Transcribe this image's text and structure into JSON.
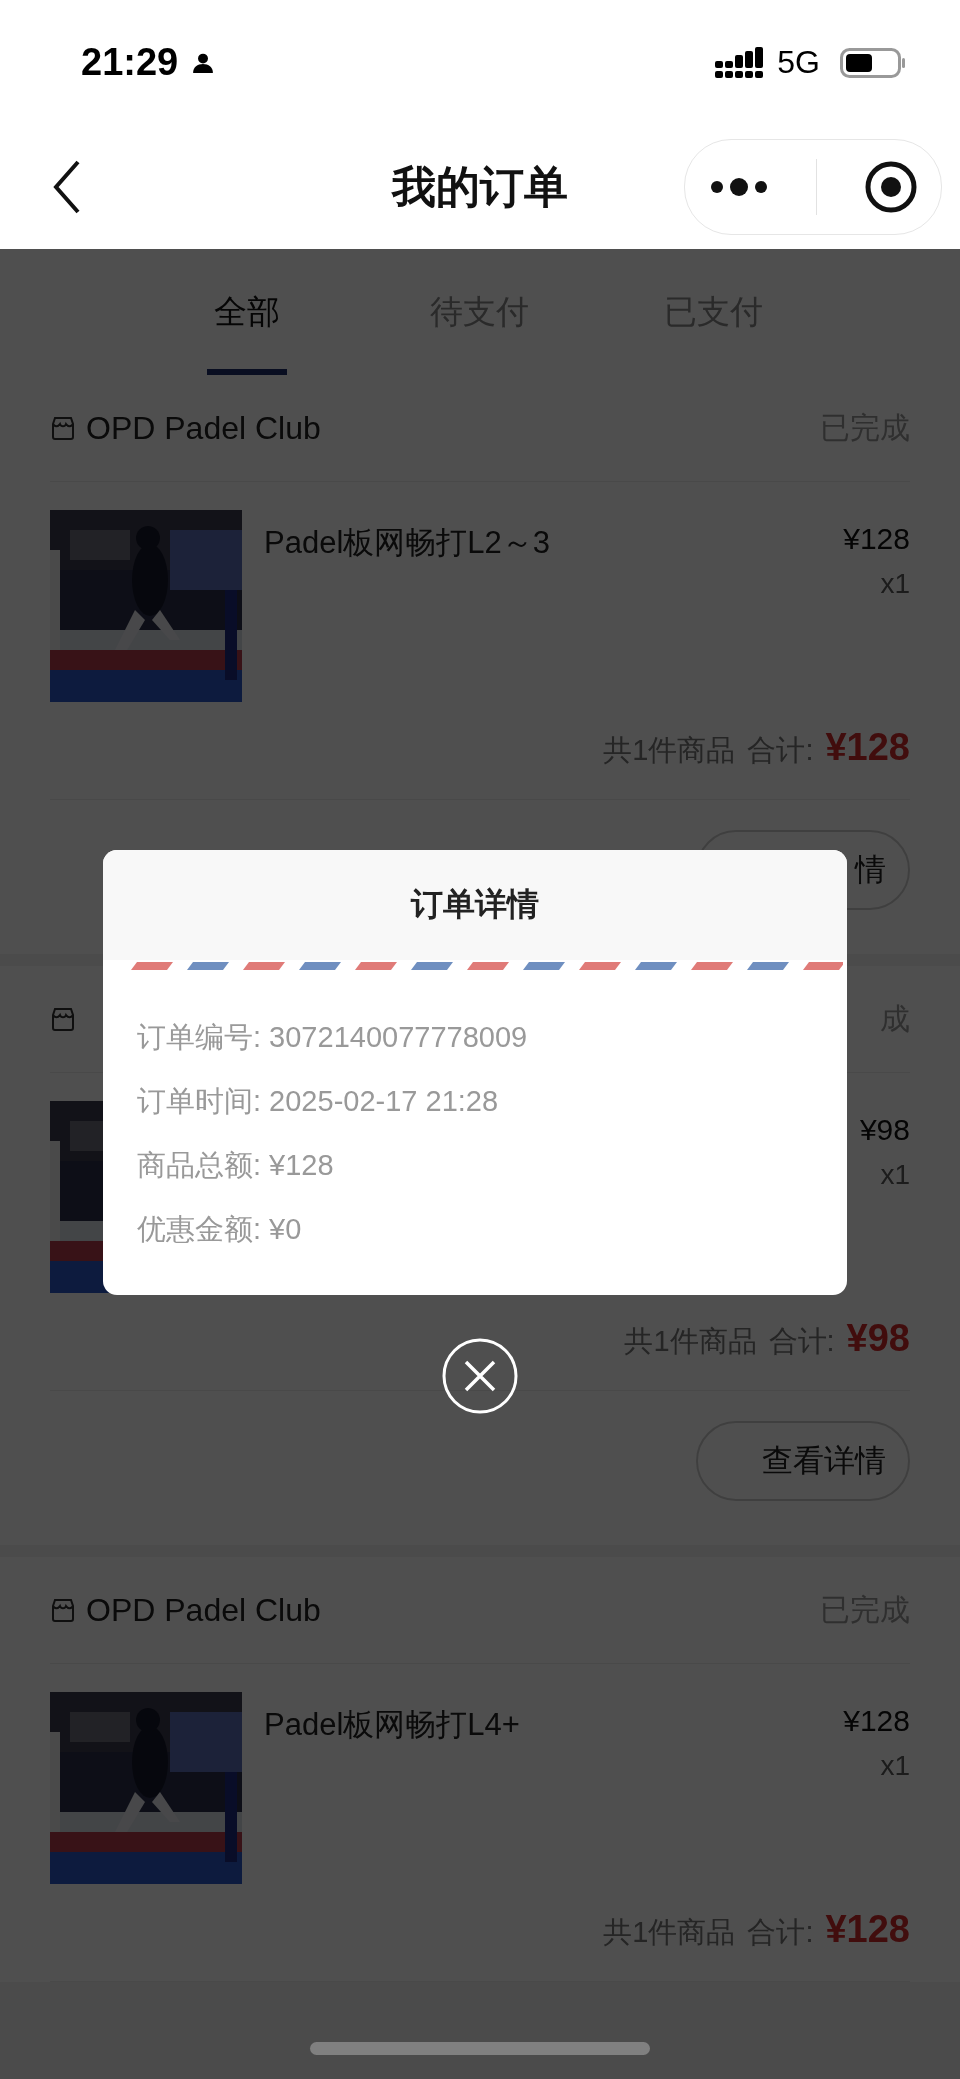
{
  "status_bar": {
    "time": "21:29",
    "network": "5G"
  },
  "nav": {
    "title": "我的订单"
  },
  "tabs": [
    {
      "label": "全部",
      "selected": true
    },
    {
      "label": "待支付",
      "selected": false
    },
    {
      "label": "已支付",
      "selected": false
    }
  ],
  "orders": [
    {
      "shop": "OPD Padel Club",
      "status": "已完成",
      "product": "Padel板网畅打L2～3",
      "price": "¥128",
      "quantity": "x1",
      "count_text": "共1件商品",
      "total_label": "合计:",
      "total": "¥128",
      "button": "情"
    },
    {
      "status": "成",
      "price": "¥98",
      "quantity": "x1",
      "count_text": "共1件商品",
      "total_label": "合计:",
      "total": "¥98",
      "button": "查看详情"
    },
    {
      "shop": "OPD Padel Club",
      "status": "已完成",
      "product": "Padel板网畅打L4+",
      "price": "¥128",
      "quantity": "x1",
      "count_text": "共1件商品",
      "total_label": "合计:",
      "total": "¥128"
    }
  ],
  "dialog": {
    "title": "订单详情",
    "rows": [
      "订单编号: 3072140077778009",
      "订单时间: 2025-02-17 21:28",
      "商品总额: ¥128",
      "优惠金额: ¥0"
    ]
  }
}
